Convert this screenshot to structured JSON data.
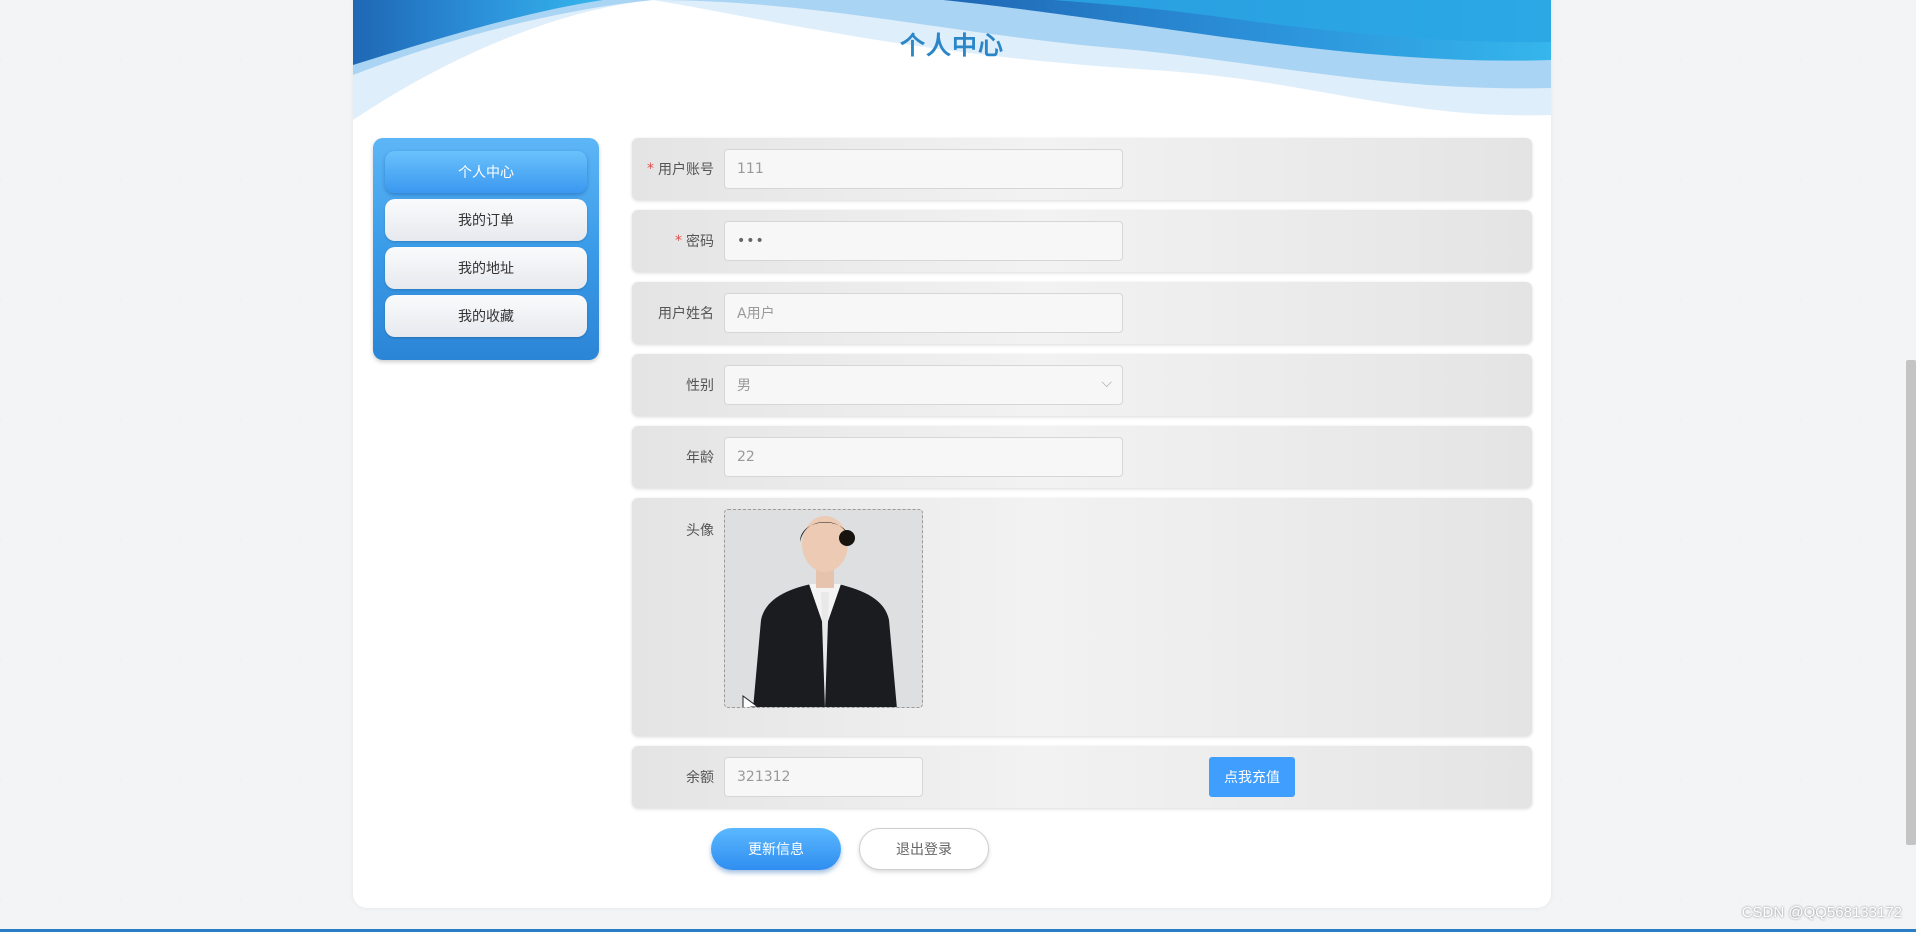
{
  "page": {
    "title": "个人中心"
  },
  "sidebar": {
    "items": [
      {
        "label": "个人中心",
        "active": true
      },
      {
        "label": "我的订单"
      },
      {
        "label": "我的地址"
      },
      {
        "label": "我的收藏"
      }
    ]
  },
  "form": {
    "account": {
      "label": "用户账号",
      "required": "*",
      "value": "111"
    },
    "password": {
      "label": "密码",
      "required": "*",
      "value": "•••"
    },
    "name": {
      "label": "用户姓名",
      "value": "A用户"
    },
    "gender": {
      "label": "性别",
      "value": "男"
    },
    "age": {
      "label": "年龄",
      "value": "22"
    },
    "avatar": {
      "label": "头像"
    },
    "balance": {
      "label": "余额",
      "value": "321312",
      "recharge_label": "点我充值"
    }
  },
  "actions": {
    "update_label": "更新信息",
    "logout_label": "退出登录"
  },
  "watermark": "CSDN @QQ568133172",
  "colors": {
    "accent": "#409eff",
    "title": "#2b86c8",
    "required": "#e04d4d"
  }
}
